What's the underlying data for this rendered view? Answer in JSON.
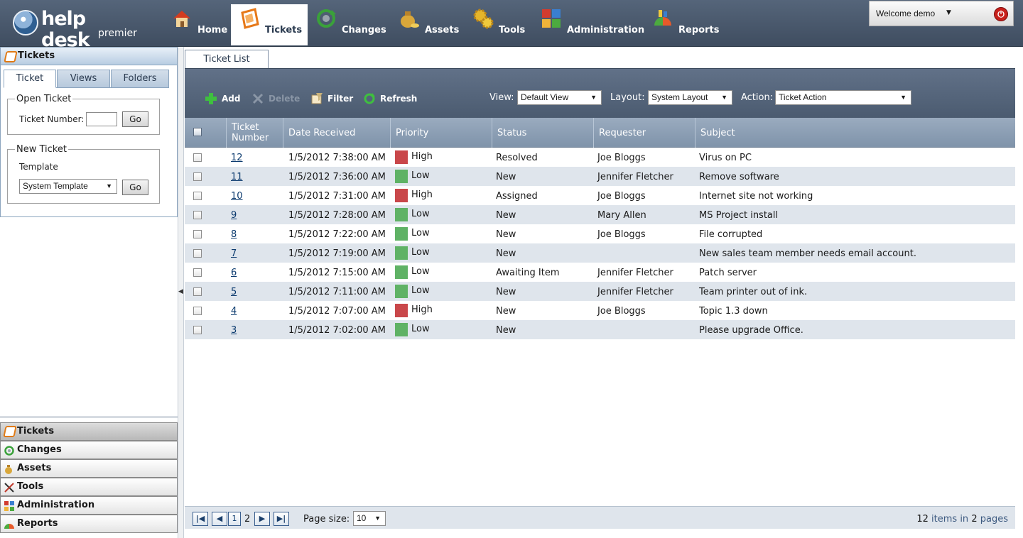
{
  "app": {
    "logo_main": "help desk",
    "logo_sub": "premier"
  },
  "nav": [
    {
      "label": "Home",
      "icon": "house-icon",
      "active": false
    },
    {
      "label": "Tickets",
      "icon": "ticket-icon",
      "active": true
    },
    {
      "label": "Changes",
      "icon": "refresh-gear-icon",
      "active": false
    },
    {
      "label": "Assets",
      "icon": "money-bag-icon",
      "active": false
    },
    {
      "label": "Tools",
      "icon": "gears-icon",
      "active": false
    },
    {
      "label": "Administration",
      "icon": "puzzle-icon",
      "active": false
    },
    {
      "label": "Reports",
      "icon": "chart-icon",
      "active": false
    }
  ],
  "user": {
    "welcome": "Welcome demo"
  },
  "left_panel": {
    "title": "Tickets",
    "tabs": [
      "Ticket",
      "Views",
      "Folders"
    ],
    "open_ticket": {
      "legend": "Open Ticket",
      "label": "Ticket Number:",
      "value": "",
      "go": "Go"
    },
    "new_ticket": {
      "legend": "New Ticket",
      "label": "Template",
      "selected": "System Template",
      "go": "Go"
    }
  },
  "accordion": [
    "Tickets",
    "Changes",
    "Assets",
    "Tools",
    "Administration",
    "Reports"
  ],
  "main": {
    "tab": "Ticket List",
    "toolbar": {
      "add": "Add",
      "delete": "Delete",
      "filter": "Filter",
      "refresh": "Refresh",
      "view_label": "View:",
      "view_value": "Default View",
      "layout_label": "Layout:",
      "layout_value": "System Layout",
      "action_label": "Action:",
      "action_value": "Ticket Action"
    },
    "columns": [
      "Ticket Number",
      "Date Received",
      "Priority",
      "Status",
      "Requester",
      "Subject"
    ],
    "rows": [
      {
        "num": "12",
        "date": "1/5/2012 7:38:00 AM",
        "priority": "High",
        "status": "Resolved",
        "requester": "Joe Bloggs",
        "subject": "Virus on PC"
      },
      {
        "num": "11",
        "date": "1/5/2012 7:36:00 AM",
        "priority": "Low",
        "status": "New",
        "requester": "Jennifer Fletcher",
        "subject": "Remove software"
      },
      {
        "num": "10",
        "date": "1/5/2012 7:31:00 AM",
        "priority": "High",
        "status": "Assigned",
        "requester": "Joe Bloggs",
        "subject": "Internet site not working"
      },
      {
        "num": "9",
        "date": "1/5/2012 7:28:00 AM",
        "priority": "Low",
        "status": "New",
        "requester": "Mary Allen",
        "subject": "MS Project install"
      },
      {
        "num": "8",
        "date": "1/5/2012 7:22:00 AM",
        "priority": "Low",
        "status": "New",
        "requester": "Joe Bloggs",
        "subject": "File corrupted"
      },
      {
        "num": "7",
        "date": "1/5/2012 7:19:00 AM",
        "priority": "Low",
        "status": "New",
        "requester": "",
        "subject": "New sales team member needs email account."
      },
      {
        "num": "6",
        "date": "1/5/2012 7:15:00 AM",
        "priority": "Low",
        "status": "Awaiting Item",
        "requester": "Jennifer Fletcher",
        "subject": "Patch server"
      },
      {
        "num": "5",
        "date": "1/5/2012 7:11:00 AM",
        "priority": "Low",
        "status": "New",
        "requester": "Jennifer Fletcher",
        "subject": "Team printer out of ink."
      },
      {
        "num": "4",
        "date": "1/5/2012 7:07:00 AM",
        "priority": "High",
        "status": "New",
        "requester": "Joe Bloggs",
        "subject": "Topic 1.3 down"
      },
      {
        "num": "3",
        "date": "1/5/2012 7:02:00 AM",
        "priority": "Low",
        "status": "New",
        "requester": "",
        "subject": "Please upgrade Office."
      }
    ],
    "priority_colors": {
      "High": "#c9474a",
      "Low": "#5fb265"
    },
    "pager": {
      "page1": "1",
      "page2": "2",
      "page_size_label": "Page size:",
      "page_size": "10",
      "items": "12",
      "items_word": "items in",
      "pages": "2",
      "pages_word": "pages"
    }
  }
}
